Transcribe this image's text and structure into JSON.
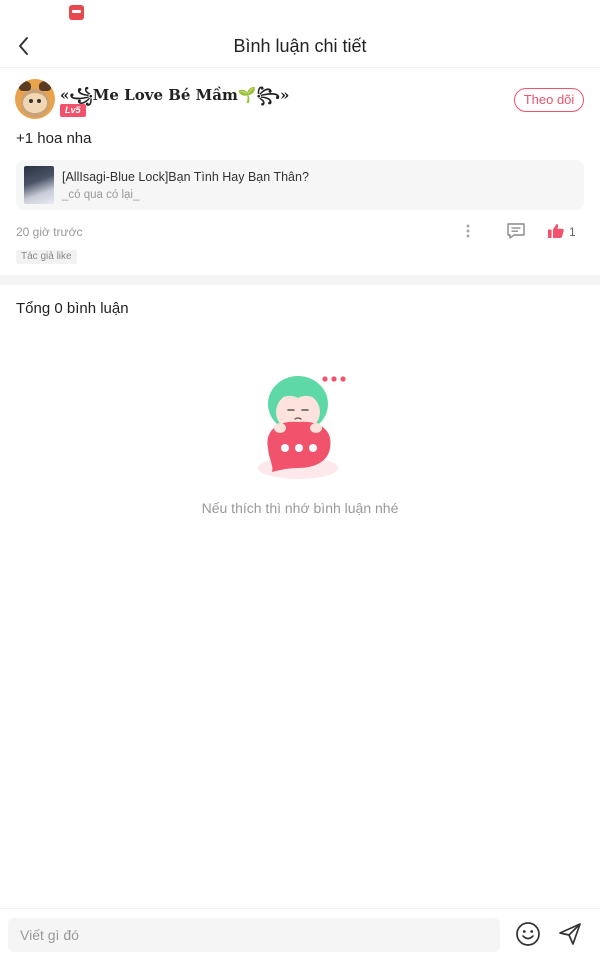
{
  "status_bar": {
    "app_icon": "manga-app-icon"
  },
  "header": {
    "title": "Bình luận chi tiết",
    "back_icon": "chevron-left-icon"
  },
  "comment": {
    "author": {
      "name": "«꧁Me Love Bé Mầm🌱꧂»",
      "level": "Lv5",
      "follow_label": "Theo dõi"
    },
    "text": "+1 hoa nha",
    "quote": {
      "title": "[AllIsagi-Blue Lock]Bạn Tình Hay Bạn Thân?",
      "subtitle": "_có qua có lại_"
    },
    "timestamp": "20 giờ trước",
    "like_count": "1",
    "author_like_tag": "Tác giả like"
  },
  "replies": {
    "total_label": "Tổng 0 bình luận",
    "empty_text": "Nếu thích thì nhớ bình luận nhé"
  },
  "composer": {
    "placeholder": "Viết gì đó"
  },
  "colors": {
    "accent": "#f0536b",
    "muted_text": "#999999",
    "mascot_hair": "#5fd8a8"
  }
}
